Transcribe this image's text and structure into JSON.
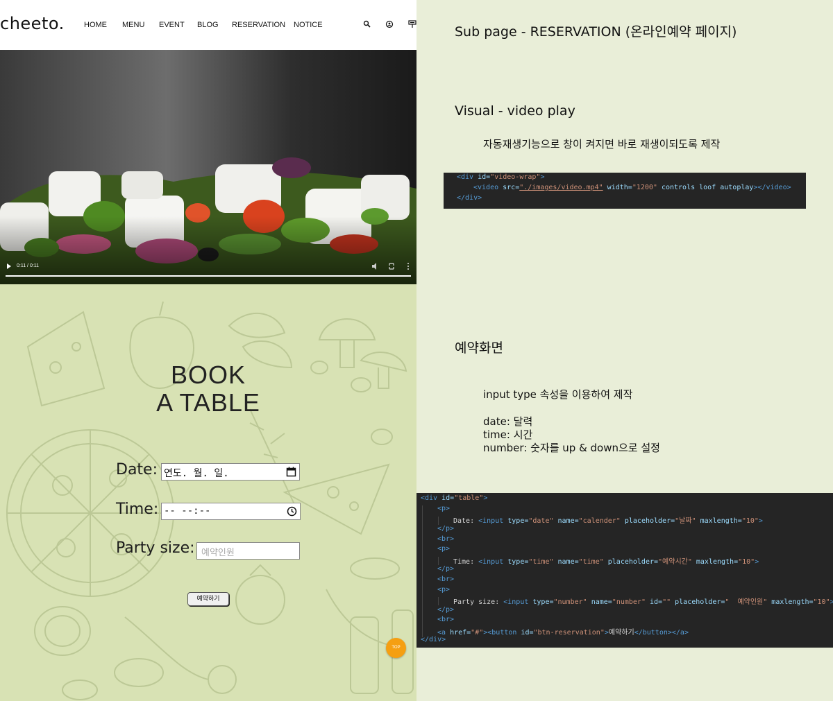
{
  "site": {
    "logo": "cheeto.",
    "nav": [
      "HOME",
      "MENU",
      "EVENT",
      "BLOG",
      "RESERVATION",
      "NOTICE"
    ],
    "header_icons": [
      "search-icon",
      "user-icon",
      "location-icon"
    ]
  },
  "video": {
    "time": "0:11 / 0:11",
    "controls": [
      "play-icon",
      "volume-icon",
      "fullscreen-icon",
      "more-icon"
    ],
    "progress": 1.0
  },
  "booking": {
    "title_line1": "BOOK",
    "title_line2": "A TABLE",
    "date_label": "Date:",
    "date_value": "연도. 월. 일.",
    "time_label": "Time:",
    "time_value": "-- --:--",
    "party_label": "Party size:",
    "party_placeholder": "예약인원",
    "reserve_button": "예약하기",
    "top_button": "TOP"
  },
  "notes": {
    "heading": "Sub page - RESERVATION (온라인예약 페이지)",
    "visual_title": "Visual - video play",
    "visual_desc": "자동재생기능으로 창이 켜지면 바로 재생이되도록 제작",
    "booking_title": "예약화면",
    "booking_desc": "input type 속성을 이용하여 제작",
    "date_note": "date: 달력",
    "time_note": "time: 시간",
    "number_note": "number: 숫자를 up & down으로 설정"
  },
  "code1": {
    "l1_tag": "<div",
    "l1_attr": " id=",
    "l1_val": "\"video-wrap\"",
    "l1_end": ">",
    "l2_tag": "<video",
    "l2_a1": " src=",
    "l2_v1": "\"./images/video.mp4\"",
    "l2_a2": " width=",
    "l2_v2": "\"1200\"",
    "l2_a3": " controls loof autoplay",
    "l2_end": "></video>",
    "l3": "</div>"
  },
  "code2": {
    "l1_tag": "<div",
    "l1_attr": " id=",
    "l1_val": "\"table\"",
    "l1_end": ">",
    "p_open": "<p>",
    "p_close": "</p>",
    "br": "<br>",
    "date_text": "Date: ",
    "date_input": "<input",
    "date_a1": " type=",
    "date_v1": "\"date\"",
    "date_a2": " name=",
    "date_v2": "\"calender\"",
    "date_a3": " placeholder=",
    "date_v3": "\"날짜\"",
    "date_a4": " maxlength=",
    "date_v4": "\"10\"",
    "date_end": ">",
    "time_text": "Time: ",
    "time_v1": "\"time\"",
    "time_v2": "\"time\"",
    "time_v3": "\"예약시간\"",
    "party_text": "Party size: ",
    "party_v1": "\"number\"",
    "party_v2": "\"number\"",
    "party_a_id": " id=",
    "party_v_id": "\"\"",
    "party_v3": "\"  예약인원\"",
    "a_tag": "<a",
    "a_attr": " href=",
    "a_val": "\"#\"",
    "btn_tag": "><button",
    "btn_attr": " id=",
    "btn_val": "\"btn-reservation\"",
    "btn_text": "예약하기",
    "btn_close": "</button></a>",
    "div_close": "</div>"
  }
}
